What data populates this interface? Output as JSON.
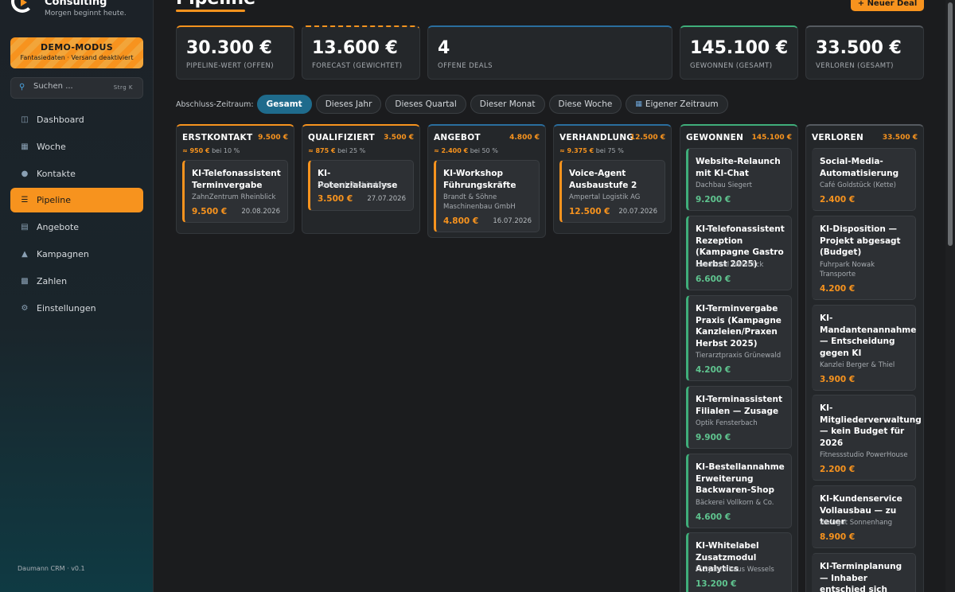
{
  "brand": {
    "name": "Consulting",
    "tagline": "Morgen beginnt heute."
  },
  "demo": {
    "title": "DEMO-MODUS",
    "subtitle": "Fantasiedaten · Versand deaktiviert"
  },
  "search": {
    "placeholder": "Suchen ...",
    "shortcut": "Strg K"
  },
  "nav": [
    {
      "label": "Dashboard",
      "icon": "chart-icon",
      "active": false
    },
    {
      "label": "Woche",
      "icon": "calendar-icon",
      "active": false
    },
    {
      "label": "Kontakte",
      "icon": "people-icon",
      "active": false
    },
    {
      "label": "Pipeline",
      "icon": "pipeline-icon",
      "active": true
    },
    {
      "label": "Angebote",
      "icon": "document-icon",
      "active": false
    },
    {
      "label": "Kampagnen",
      "icon": "megaphone-icon",
      "active": false
    },
    {
      "label": "Zahlen",
      "icon": "bar-chart-icon",
      "active": false
    },
    {
      "label": "Einstellungen",
      "icon": "gear-icon",
      "active": false
    }
  ],
  "version": "Daumann CRM · v0.1",
  "page": {
    "title": "Pipeline",
    "new_deal": "+ Neuer Deal"
  },
  "kpis": [
    {
      "value": "30.300 €",
      "label": "PIPELINE-WERT (OFFEN)"
    },
    {
      "value": "13.600 €",
      "label": "FORECAST (GEWICHTET)"
    },
    {
      "value": "4",
      "label": "OFFENE DEALS"
    },
    {
      "value": "145.100 €",
      "label": "GEWONNEN (GESAMT)"
    },
    {
      "value": "33.500 €",
      "label": "VERLOREN (GESAMT)"
    }
  ],
  "filters": {
    "label": "Abschluss-Zeitraum:",
    "options": [
      "Gesamt",
      "Dieses Jahr",
      "Dieses Quartal",
      "Dieser Monat",
      "Diese Woche",
      "Eigener Zeitraum"
    ],
    "active": "Gesamt"
  },
  "columns": [
    {
      "name": "ERSTKONTAKT",
      "sum": "9.500 €",
      "weighted": "≈ 950 €",
      "prob": "bei 10 %",
      "cards": [
        {
          "title": "KI-Telefonassistent Terminvergabe",
          "company": "ZahnZentrum Rheinblick",
          "amount": "9.500 €",
          "date": "20.08.2026"
        }
      ]
    },
    {
      "name": "QUALIFIZIERT",
      "sum": "3.500 €",
      "weighted": "≈ 875 €",
      "prob": "bei 25 %",
      "cards": [
        {
          "title": "KI-Potenzialanalyse",
          "company": "Stellwerk Architekten",
          "amount": "3.500 €",
          "date": "27.07.2026"
        }
      ]
    },
    {
      "name": "ANGEBOT",
      "sum": "4.800 €",
      "weighted": "≈ 2.400 €",
      "prob": "bei 50 %",
      "cards": [
        {
          "title": "KI-Workshop Führungskräfte",
          "company": "Brandt & Söhne Maschinenbau GmbH",
          "amount": "4.800 €",
          "date": "16.07.2026"
        }
      ]
    },
    {
      "name": "VERHANDLUNG",
      "sum": "12.500 €",
      "weighted": "≈ 9.375 €",
      "prob": "bei 75 %",
      "cards": [
        {
          "title": "Voice-Agent Ausbaustufe 2",
          "company": "Ampertal Logistik AG",
          "amount": "12.500 €",
          "date": "20.07.2026"
        }
      ]
    },
    {
      "name": "GEWONNEN",
      "sum": "145.100 €",
      "cards": [
        {
          "title": "Website-Relaunch mit KI-Chat",
          "company": "Dachbau Siegert",
          "amount": "9.200 €"
        },
        {
          "title": "KI-Telefonassistent Rezeption (Kampagne Gastro Herbst 2025)",
          "company": "Landhotel Waldblick",
          "amount": "6.600 €"
        },
        {
          "title": "KI-Terminvergabe Praxis (Kampagne Kanzleien/Praxen Herbst 2025)",
          "company": "Tierarztpraxis Grünewald",
          "amount": "4.200 €"
        },
        {
          "title": "KI-Terminassistent Filialen — Zusage",
          "company": "Optik Fensterbach",
          "amount": "9.900 €"
        },
        {
          "title": "KI-Bestellannahme Erweiterung Backwaren-Shop",
          "company": "Bäckerei Vollkorn & Co.",
          "amount": "4.600 €"
        },
        {
          "title": "KI-Whitelabel Zusatzmodul Analytics",
          "company": "IT-Systemhaus Wessels",
          "amount": "13.200 €"
        }
      ]
    },
    {
      "name": "VERLOREN",
      "sum": "33.500 €",
      "cards": [
        {
          "title": "Social-Media-Automatisierung",
          "company": "Café Goldstück (Kette)",
          "amount": "2.400 €"
        },
        {
          "title": "KI-Disposition — Projekt abgesagt (Budget)",
          "company": "Fuhrpark Nowak Transporte",
          "amount": "4.200 €"
        },
        {
          "title": "KI-Mandantenannahme — Entscheidung gegen KI",
          "company": "Kanzlei Berger & Thiel",
          "amount": "3.900 €"
        },
        {
          "title": "KI-Mitgliederverwaltung — kein Budget für 2026",
          "company": "Fitnessstudio PowerHouse",
          "amount": "2.200 €"
        },
        {
          "title": "KI-Kundenservice Vollausbau — zu teuer",
          "company": "Weingut Sonnenhang",
          "amount": "8.900 €"
        },
        {
          "title": "KI-Terminplanung — Inhaber entschied sich gegen Digitalisierung",
          "company": "",
          "amount": ""
        }
      ]
    }
  ]
}
